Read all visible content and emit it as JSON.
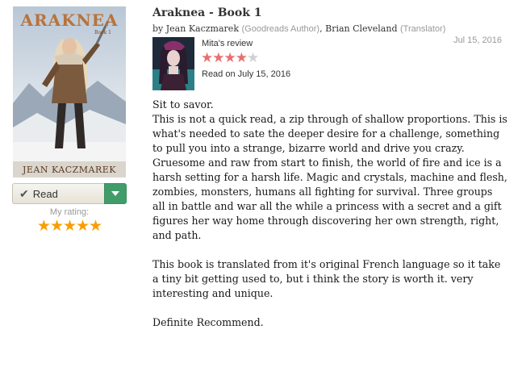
{
  "book": {
    "cover_title": "ARAKNEA",
    "cover_subtitle": "Book 1",
    "cover_author": "JEAN KACZMAREK",
    "title": "Araknea - Book 1"
  },
  "shelf": {
    "status_label": "Read",
    "my_rating_label": "My rating:",
    "my_rating_stars": "★★★★★",
    "my_rating_value": 5
  },
  "byline": {
    "by": "by",
    "author": "Jean Kaczmarek",
    "author_role": "(Goodreads Author)",
    "separator": ",",
    "translator": "Brian Cleveland",
    "translator_role": "(Translator)"
  },
  "review": {
    "date": "Jul 15, 2016",
    "reviewer_label": "Mita's review",
    "rating": 4,
    "max_rating": 5,
    "stars_on": "★★★★",
    "stars_off": "★",
    "read_on": "Read on July 15, 2016",
    "paragraphs": [
      "Sit to savor.",
      "This is not a quick read, a zip through of shallow proportions. This is what's needed to sate the deeper desire for a challenge, something to pull you into a strange, bizarre world and drive you crazy.",
      "Gruesome and raw from start to finish, the world of fire and ice is a harsh setting for a harsh life. Magic and crystals, machine and flesh, zombies, monsters, humans all fighting for survival. Three groups all in battle and war all the while a princess with a secret and a gift figures her way home through discovering her own strength, right, and path.",
      "This book is translated from it's original French language so it take a tiny bit getting used to, but i think the story is worth it. very interesting and unique.",
      "Definite Recommend."
    ]
  },
  "colors": {
    "dropdown_green": "#409d69",
    "my_rating_star": "#fa9d00",
    "review_star": "#e96f6f",
    "muted_text": "#999999"
  },
  "icons": {
    "check": "check-icon",
    "dropdown": "chevron-down-icon"
  }
}
